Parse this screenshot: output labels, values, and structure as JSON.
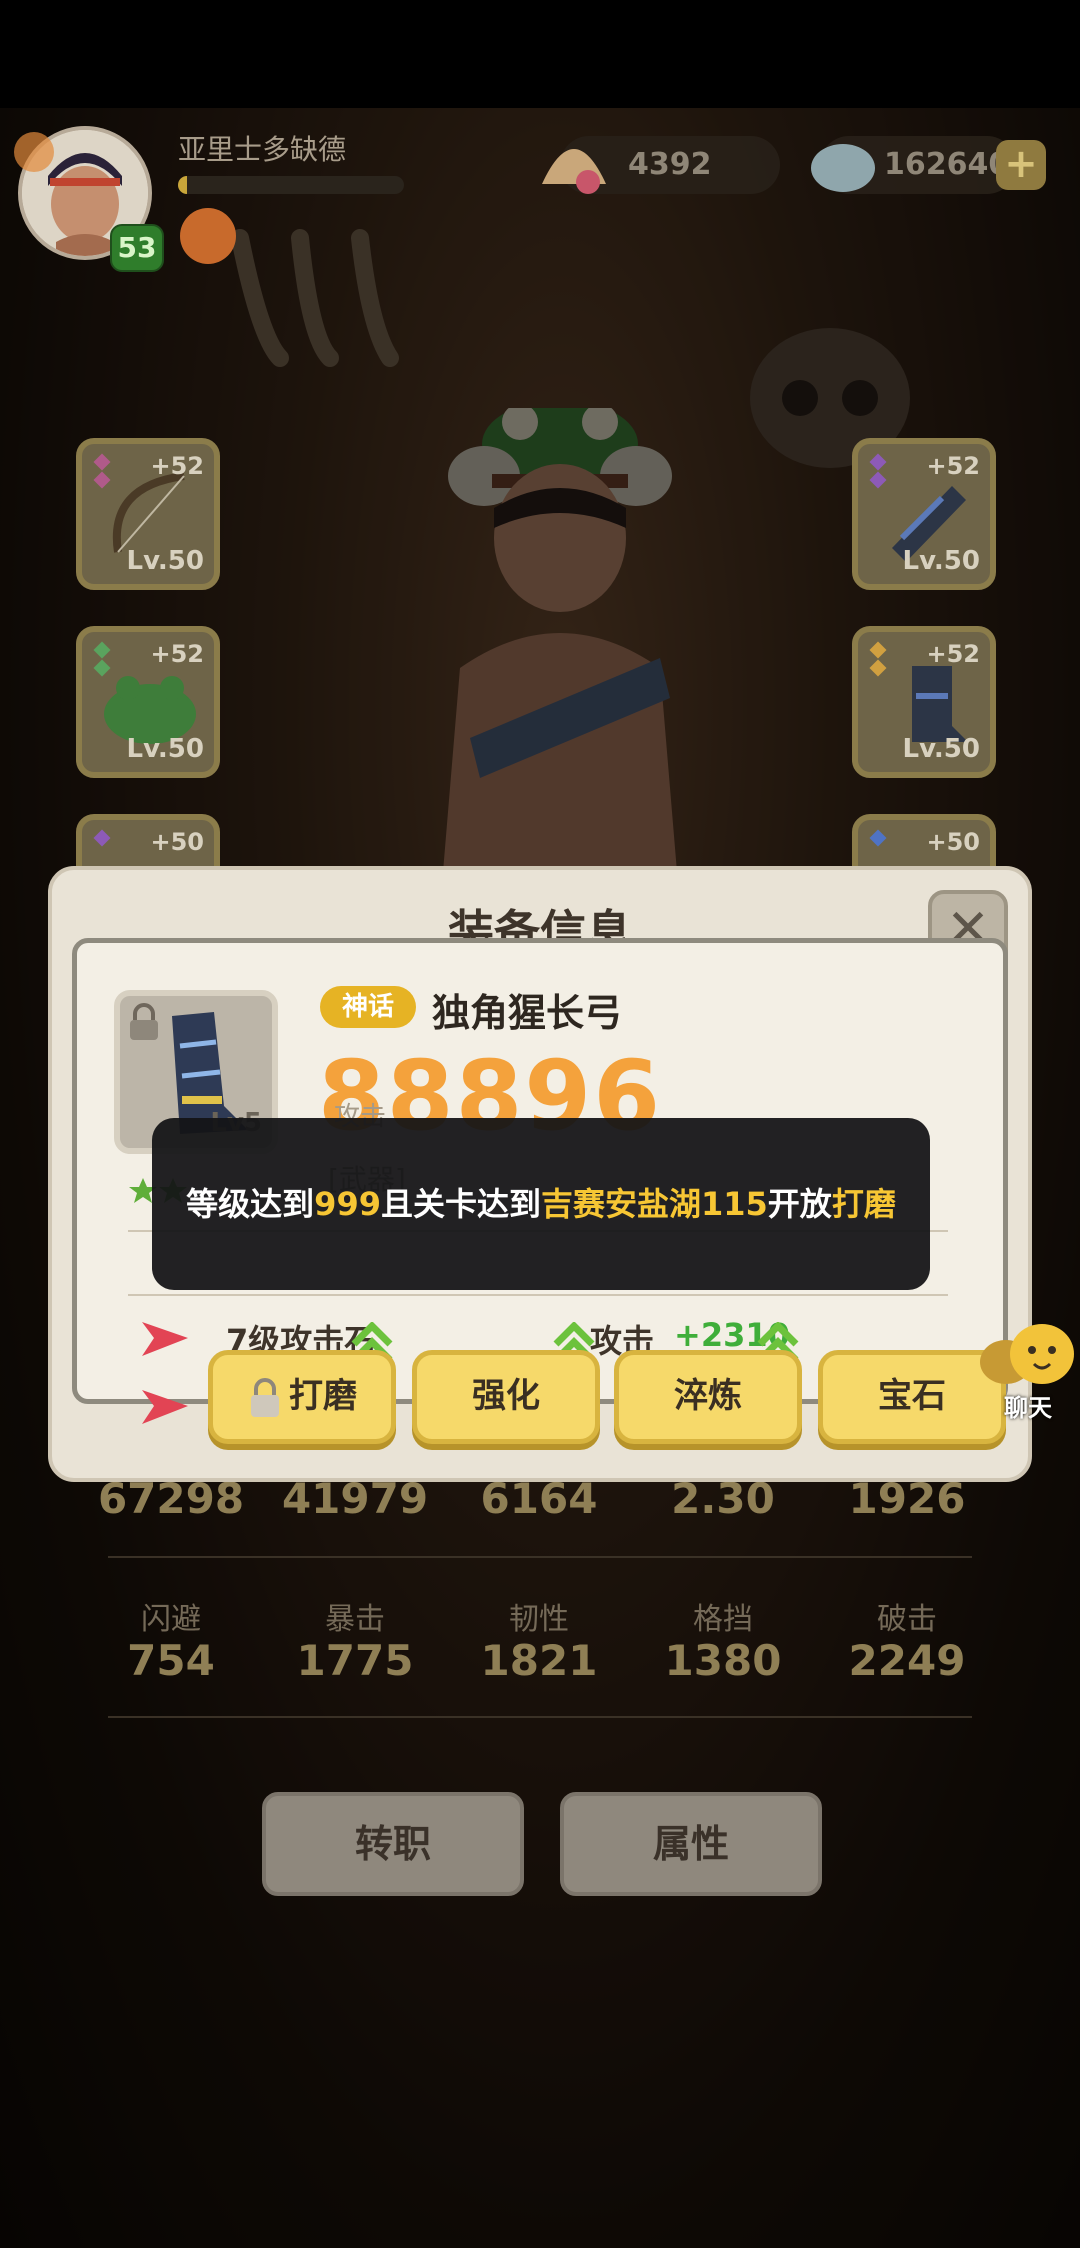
{
  "player": {
    "name": "亚里士多缺德",
    "level": "53",
    "xp_fraction": 0.04
  },
  "currency": {
    "gold": "4392",
    "diamonds": "162640"
  },
  "slots": [
    {
      "plus": "+52",
      "level": "Lv.50",
      "item": "bow",
      "gem_color": "#b05a8a"
    },
    {
      "plus": "+52",
      "level": "Lv.50",
      "item": "bracer",
      "gem_color": "#8d5ab7"
    },
    {
      "plus": "+52",
      "level": "Lv.50",
      "item": "frog-hat",
      "gem_color": "#5aa35e"
    },
    {
      "plus": "+52",
      "level": "Lv.50",
      "item": "boot",
      "gem_color": "#d1a040"
    },
    {
      "plus": "+50",
      "item": "glove",
      "gem_color": "#8d5ab7"
    },
    {
      "plus": "+50",
      "item": "armor",
      "gem_color": "#4f73c4"
    }
  ],
  "stats": {
    "row1_values": [
      "67298",
      "41979",
      "6164",
      "2.30",
      "1926"
    ],
    "row2_labels": [
      "闪避",
      "暴击",
      "韧性",
      "格挡",
      "破击"
    ],
    "row2_values": [
      "754",
      "1775",
      "1821",
      "1380",
      "2249"
    ]
  },
  "bottom_buttons": {
    "job_change": "转职",
    "attributes": "属性"
  },
  "modal": {
    "title": "装备信息",
    "close": "✕",
    "item_level": "Lv5",
    "rarity": "神话",
    "item_name": "独角猩长弓",
    "power": "88896",
    "power_label": "攻击",
    "type": "[武器]",
    "gem1_name": "7级攻击石",
    "bonus_label": "攻击",
    "bonus_value": "+2310",
    "toast": {
      "p1": "等级达到",
      "v1": "999",
      "p2": "且关卡达到",
      "v2": "吉赛安盐湖115",
      "p3": "开放",
      "v3": "打磨"
    },
    "actions": {
      "grind": "打磨",
      "enhance": "强化",
      "refine": "淬炼",
      "gem": "宝石"
    }
  },
  "chat": {
    "label": "聊天"
  },
  "colors": {
    "accent_gold": "#f7c634",
    "power_orange": "#f4a23c",
    "bonus_green": "#3fae3a",
    "button_yellow": "#f6d96a"
  }
}
